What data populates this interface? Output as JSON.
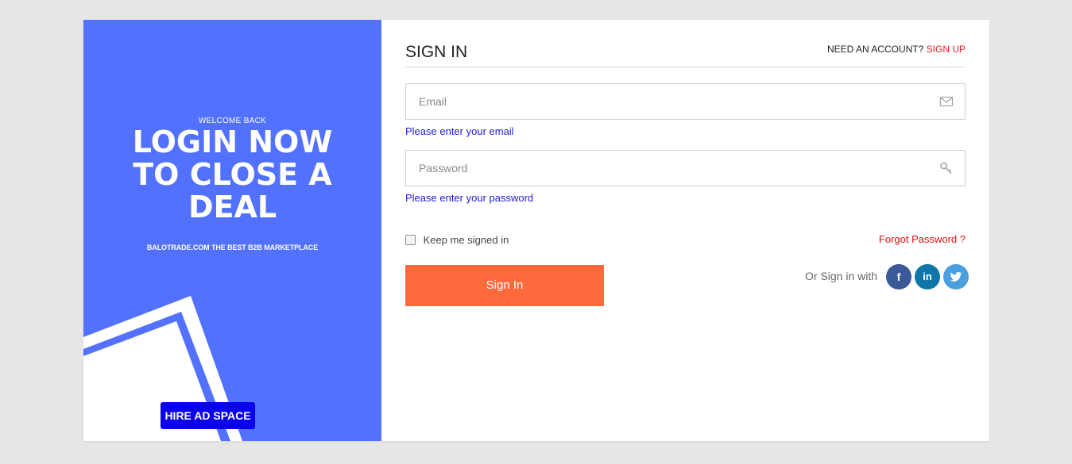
{
  "promo": {
    "welcome": "WELCOME BACK",
    "headline_lines": [
      "LOGIN NOW",
      "TO CLOSE A",
      "DEAL"
    ],
    "tagline": "BALOTRADE.COM THE BEST B2B MARKETPLACE",
    "ad_button": "HIRE AD SPACE",
    "background_color": "#5271ff"
  },
  "form": {
    "title": "SIGN IN",
    "account_prompt": "NEED AN ACCOUNT?",
    "signup_link": "SIGN UP",
    "email": {
      "placeholder": "Email",
      "value": "",
      "icon": "envelope-icon",
      "hint": "Please enter your email"
    },
    "password": {
      "placeholder": "Password",
      "value": "",
      "icon": "key-icon",
      "hint": "Please enter your password"
    },
    "remember_label": "Keep me signed in",
    "remember_checked": false,
    "forgot_link": "Forgot Password ?",
    "signin_button": "Sign In",
    "social_label": "Or Sign in with",
    "social": [
      {
        "name": "facebook",
        "glyph": "f",
        "color": "#3b5998"
      },
      {
        "name": "linkedin",
        "glyph": "in",
        "color": "#0e76a8"
      },
      {
        "name": "twitter",
        "glyph": "twitter-bird",
        "color": "#4a9fde"
      }
    ]
  },
  "colors": {
    "page_background": "#e6e6e6",
    "accent_button": "#ff6a3d",
    "ad_button": "#0a00ec",
    "link_red": "#e32222",
    "hint_blue": "#1f1fc8"
  }
}
